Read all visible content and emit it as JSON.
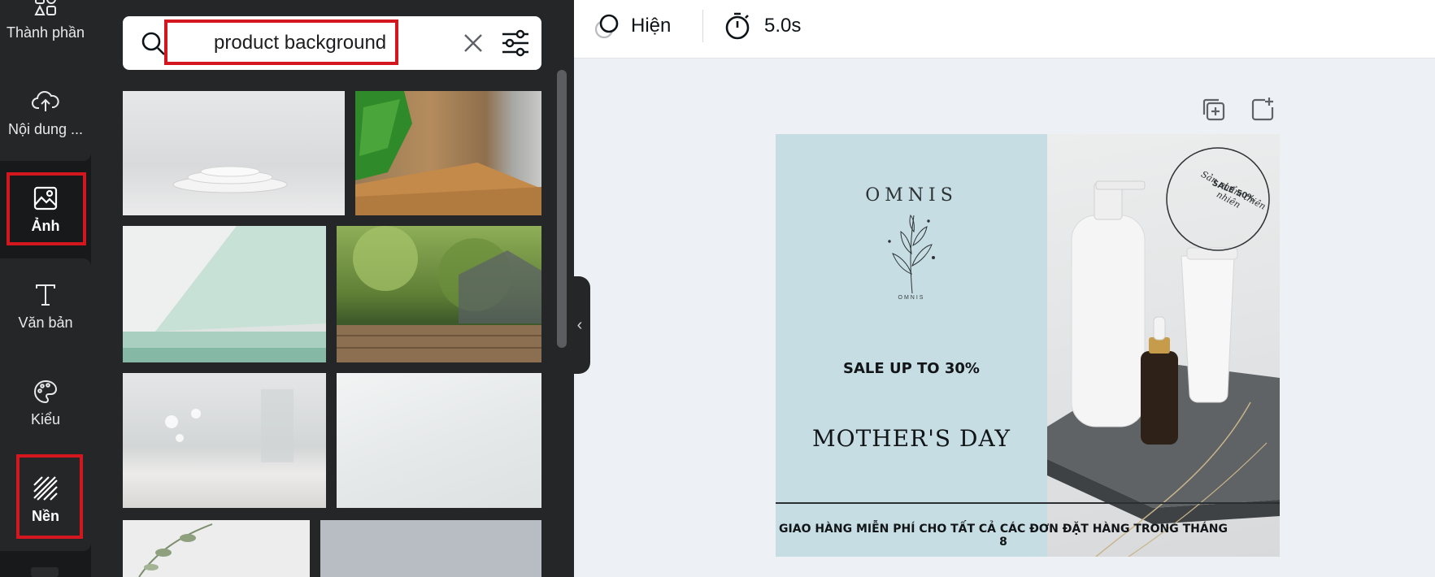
{
  "rail": {
    "items": [
      {
        "label": "Thành phần"
      },
      {
        "label": "Nội dung ..."
      },
      {
        "label": "Ảnh"
      },
      {
        "label": "Văn bản"
      },
      {
        "label": "Kiểu"
      },
      {
        "label": "Nền"
      }
    ],
    "highlight_color": "#d4161e"
  },
  "search": {
    "value": "product background",
    "icons": [
      "search-icon",
      "close-icon",
      "filter-sliders-icon"
    ]
  },
  "topbar": {
    "animate_label": "Hiện",
    "duration_label": "5.0s"
  },
  "design": {
    "brand": "OMNIS",
    "brand_small": "OMNIS",
    "badge_line1": "Sản phẩm thiên nhiên",
    "badge_line2": "SALE 50%",
    "sale_text": "SALE UP TO 30%",
    "headline": "MOTHER'S DAY",
    "footer": "GIAO HÀNG MIỄN PHÍ CHO TẤT CẢ CÁC ĐƠN ĐẶT HÀNG TRONG THÁNG 8",
    "bg_left": "#c5dde3"
  }
}
